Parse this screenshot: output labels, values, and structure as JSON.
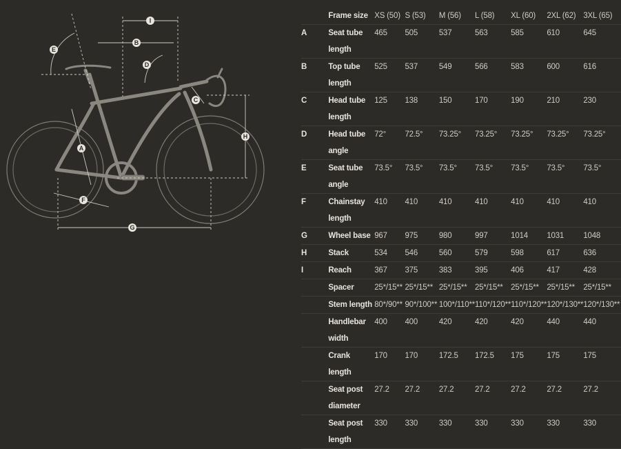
{
  "diagram": {
    "labels": [
      "A",
      "B",
      "C",
      "D",
      "E",
      "F",
      "G",
      "H",
      "I"
    ]
  },
  "table": {
    "header": {
      "label": "Frame size",
      "sizes": [
        "XS (50)",
        "S (53)",
        "M (56)",
        "L (58)",
        "XL (60)",
        "2XL (62)",
        "3XL (65)"
      ]
    },
    "rows": [
      {
        "letter": "A",
        "name": "Seat tube length",
        "values": [
          "465",
          "505",
          "537",
          "563",
          "585",
          "610",
          "645"
        ]
      },
      {
        "letter": "B",
        "name": "Top tube length",
        "values": [
          "525",
          "537",
          "549",
          "566",
          "583",
          "600",
          "616"
        ]
      },
      {
        "letter": "C",
        "name": "Head tube length",
        "values": [
          "125",
          "138",
          "150",
          "170",
          "190",
          "210",
          "230"
        ]
      },
      {
        "letter": "D",
        "name": "Head tube angle",
        "values": [
          "72°",
          "72.5°",
          "73.25°",
          "73.25°",
          "73.25°",
          "73.25°",
          "73.25°"
        ]
      },
      {
        "letter": "E",
        "name": "Seat tube angle",
        "values": [
          "73.5°",
          "73.5°",
          "73.5°",
          "73.5°",
          "73.5°",
          "73.5°",
          "73.5°"
        ]
      },
      {
        "letter": "F",
        "name": "Chainstay length",
        "values": [
          "410",
          "410",
          "410",
          "410",
          "410",
          "410",
          "410"
        ]
      },
      {
        "letter": "G",
        "name": "Wheel base",
        "values": [
          "967",
          "975",
          "980",
          "997",
          "1014",
          "1031",
          "1048"
        ]
      },
      {
        "letter": "H",
        "name": "Stack",
        "values": [
          "534",
          "546",
          "560",
          "579",
          "598",
          "617",
          "636"
        ]
      },
      {
        "letter": "I",
        "name": "Reach",
        "values": [
          "367",
          "375",
          "383",
          "395",
          "406",
          "417",
          "428"
        ]
      },
      {
        "letter": "",
        "name": "Spacer",
        "values": [
          "25*/15**",
          "25*/15**",
          "25*/15**",
          "25*/15**",
          "25*/15**",
          "25*/15**",
          "25*/15**"
        ]
      },
      {
        "letter": "",
        "name": "Stem length",
        "values": [
          "80*/90**",
          "90*/100**",
          "100*/110**",
          "110*/120**",
          "110*/120**",
          "120*/130**",
          "120*/130**"
        ]
      },
      {
        "letter": "",
        "name": "Handlebar width",
        "values": [
          "400",
          "400",
          "420",
          "420",
          "420",
          "440",
          "440"
        ]
      },
      {
        "letter": "",
        "name": "Crank length",
        "values": [
          "170",
          "170",
          "172.5",
          "172.5",
          "175",
          "175",
          "175"
        ]
      },
      {
        "letter": "",
        "name": "Seat post diameter",
        "values": [
          "27.2",
          "27.2",
          "27.2",
          "27.2",
          "27.2",
          "27.2",
          "27.2"
        ]
      },
      {
        "letter": "",
        "name": "Seat post length",
        "values": [
          "330",
          "330",
          "330",
          "330",
          "330",
          "330",
          "330"
        ]
      }
    ]
  },
  "colors": {
    "background": "#2c2b28",
    "frame": "#8a8780",
    "dimension": "#cfccc4",
    "label_fill": "#e8e5de"
  }
}
